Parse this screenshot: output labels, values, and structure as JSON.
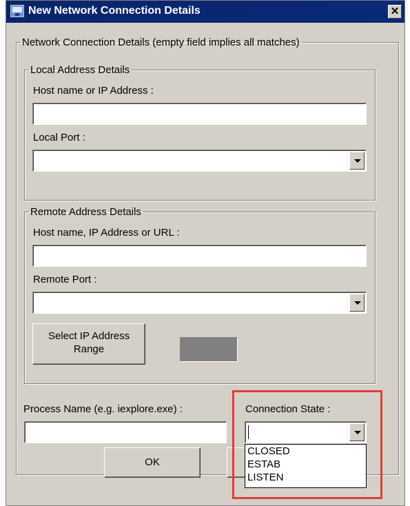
{
  "window": {
    "title": "New Network Connection Details",
    "close_glyph": "✕"
  },
  "details_group": {
    "legend": "Network Connection Details (empty field implies all matches)"
  },
  "local": {
    "legend": "Local Address Details",
    "host_label": "Host name or IP Address :",
    "host_value": "",
    "port_label": "Local Port :",
    "port_value": ""
  },
  "remote": {
    "legend": "Remote Address Details",
    "host_label": "Host name, IP Address or URL :",
    "host_value": "",
    "port_label": "Remote Port :",
    "port_value": "",
    "select_range_line1": "Select IP Address",
    "select_range_line2": "Range",
    "range_swatch_color": "#808080"
  },
  "process": {
    "label": "Process Name (e.g. iexplore.exe) :",
    "value": ""
  },
  "connection_state": {
    "label": "Connection State :",
    "value": "",
    "options": [
      "CLOSED",
      "ESTAB",
      "LISTEN"
    ]
  },
  "buttons": {
    "ok": "OK"
  },
  "colors": {
    "titlebar": "#0a246a",
    "dialog_bg": "#d4d0c8",
    "highlight": "#e23b3b"
  }
}
